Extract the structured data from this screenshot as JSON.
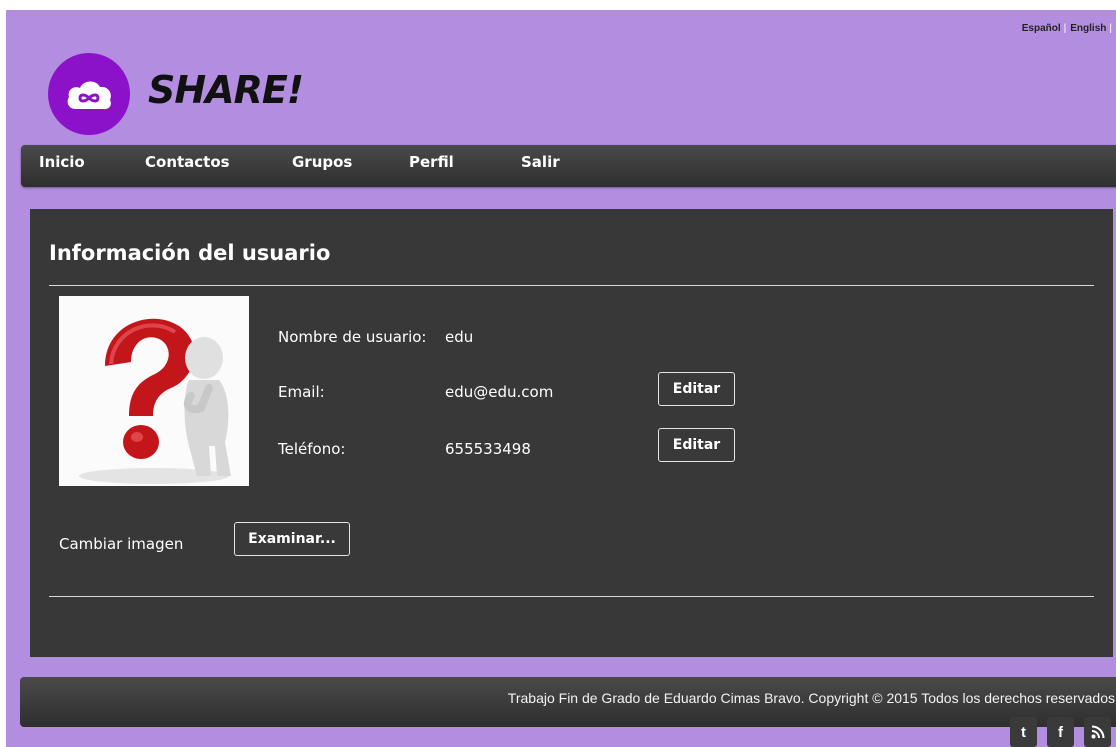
{
  "languages": [
    "Español",
    "English"
  ],
  "brand": {
    "name": "SHARE!",
    "accent": "#8c12c9"
  },
  "nav": {
    "items": [
      "Inicio",
      "Contactos",
      "Grupos",
      "Perfil",
      "Salir"
    ]
  },
  "profile": {
    "title": "Información del usuario",
    "fields": [
      {
        "label": "Nombre de usuario:",
        "value": "edu"
      },
      {
        "label": "Email:",
        "value": "edu@edu.com",
        "action": "Editar"
      },
      {
        "label": "Teléfono:",
        "value": "655533498",
        "action": "Editar"
      }
    ],
    "change_image_label": "Cambiar imagen",
    "browse_label": "Examinar..."
  },
  "footer": {
    "text": "Trabajo Fin de Grado de Eduardo Cimas Bravo. Copyright © 2015 Todos los derechos reservados",
    "social": [
      "twitter-icon",
      "facebook-icon",
      "rss-icon"
    ]
  },
  "colors": {
    "background": "#b38ee0",
    "panel": "#383838",
    "nav": "#3c3c3c"
  }
}
